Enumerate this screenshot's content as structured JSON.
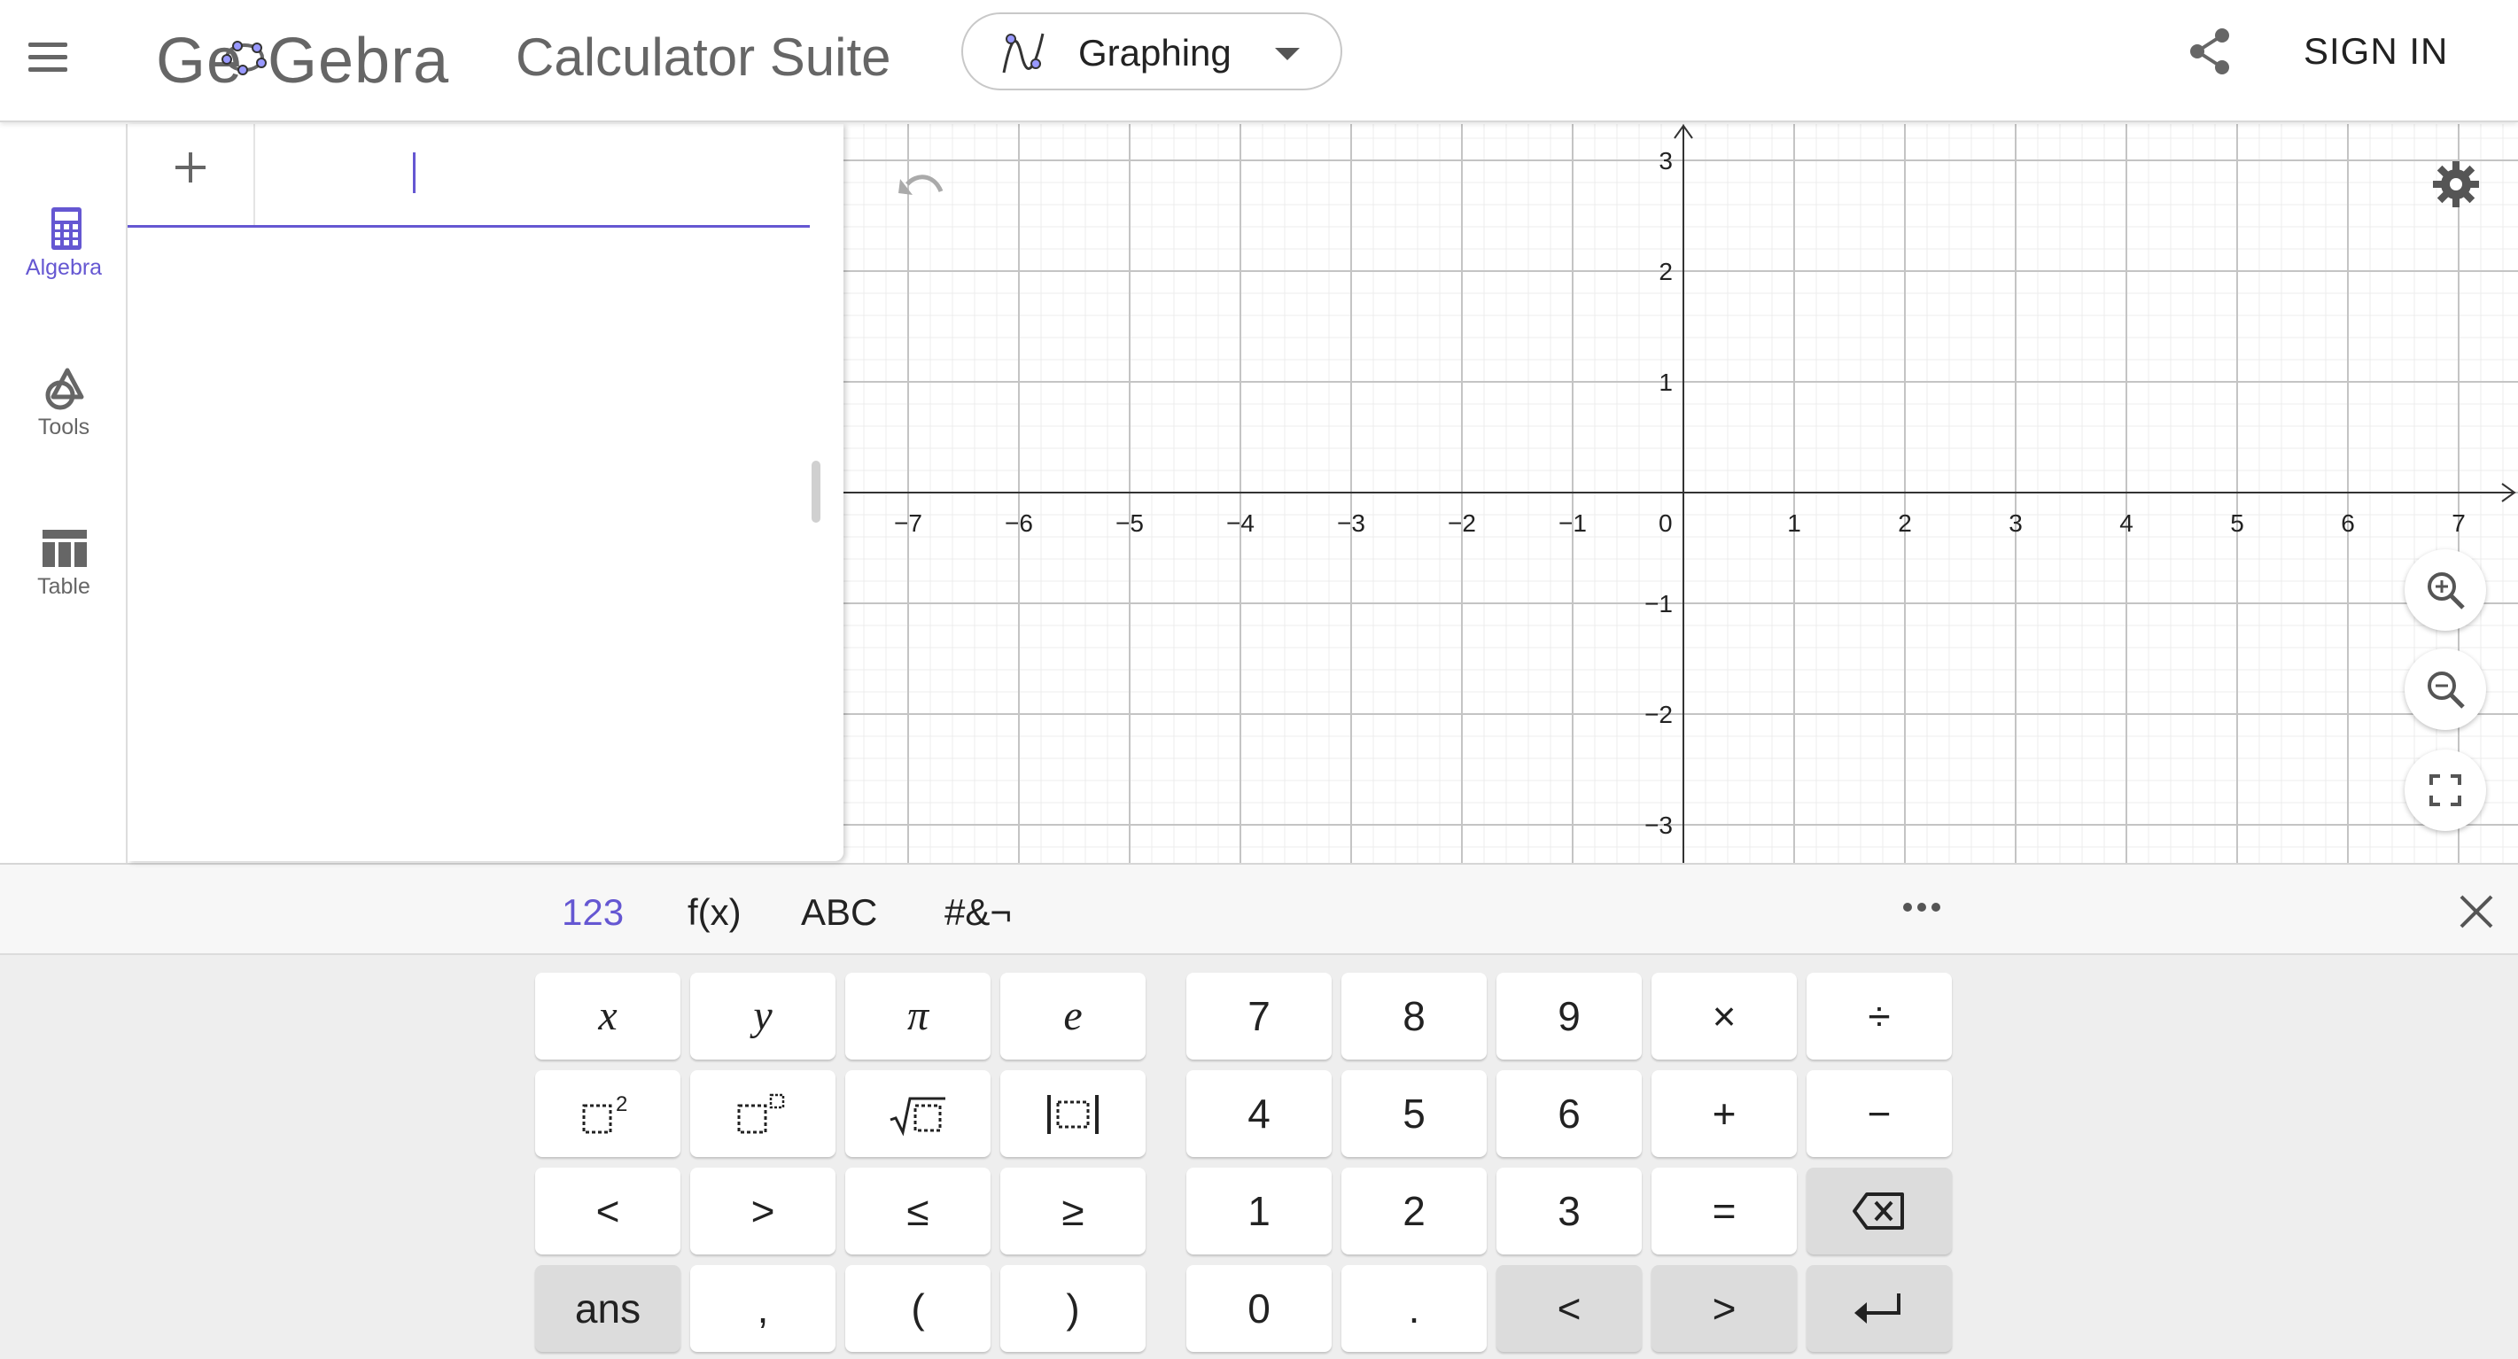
{
  "header": {
    "logo_text": "GeoGebra",
    "suite_title": "Calculator Suite",
    "app_picker": {
      "selected": "Graphing"
    },
    "sign_in_label": "SIGN IN"
  },
  "sidebar": {
    "items": [
      {
        "label": "Algebra",
        "icon": "calculator-icon",
        "active": true
      },
      {
        "label": "Tools",
        "icon": "shapes-icon",
        "active": false
      },
      {
        "label": "Table",
        "icon": "table-icon",
        "active": false
      }
    ]
  },
  "algebra": {
    "input_value": ""
  },
  "graph": {
    "x_ticks": [
      "−7",
      "−6",
      "−5",
      "−4",
      "−3",
      "−2",
      "−1",
      "0",
      "1",
      "2",
      "3",
      "4",
      "5",
      "6",
      "7"
    ],
    "y_ticks": [
      "3",
      "2",
      "1",
      "−1",
      "−2",
      "−3"
    ],
    "xlim": [
      -7.7,
      7.8
    ],
    "ylim": [
      -3.3,
      3.3
    ],
    "grid": true,
    "accent_color": "#6557d2"
  },
  "keyboard": {
    "tabs": [
      {
        "label": "123",
        "active": true
      },
      {
        "label": "f(x)",
        "active": false
      },
      {
        "label": "ABC",
        "active": false
      },
      {
        "label": "#&¬",
        "active": false
      }
    ],
    "left_keys": [
      [
        "x",
        "y",
        "π",
        "e"
      ],
      [
        "square",
        "power",
        "sqrt",
        "abs"
      ],
      [
        "<",
        ">",
        "≤",
        "≥"
      ],
      [
        "ans",
        ",",
        "(",
        ")"
      ]
    ],
    "right_keys": [
      [
        "7",
        "8",
        "9",
        "×",
        "÷"
      ],
      [
        "4",
        "5",
        "6",
        "+",
        "−"
      ],
      [
        "1",
        "2",
        "3",
        "=",
        "backspace"
      ],
      [
        "0",
        ".",
        "<",
        ">",
        "enter"
      ]
    ]
  }
}
